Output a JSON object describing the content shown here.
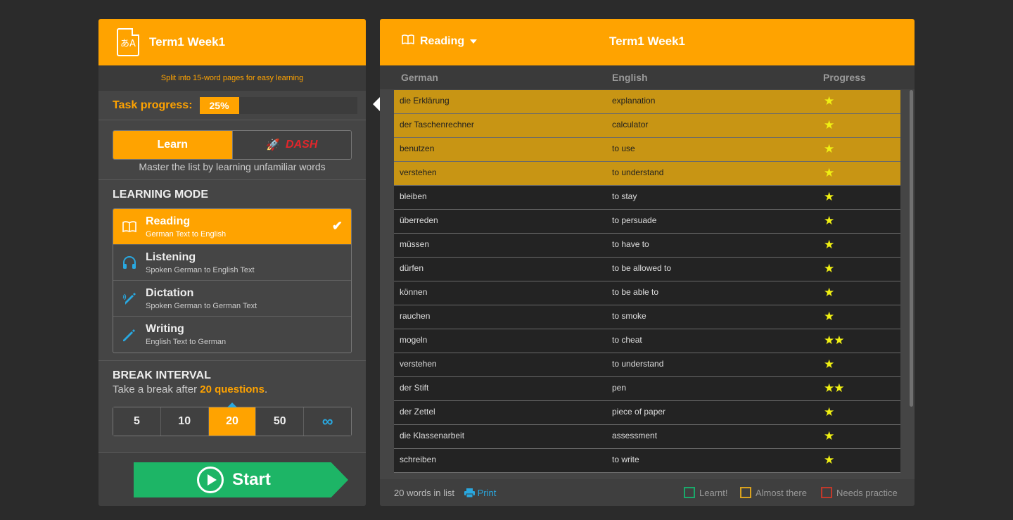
{
  "left": {
    "title": "Term1 Week1",
    "icon": "translate-doc-icon",
    "split_text": "Split into 15-word pages for easy learning",
    "task_label": "Task progress:",
    "task_progress_text": "25%",
    "task_progress": 0.25,
    "learn_label": "Learn",
    "dash_label": "DASH",
    "learn_desc": "Master the list by learning unfamiliar words",
    "mode_section_title": "LEARNING MODE",
    "modes": [
      {
        "name": "Reading",
        "sub": "German Text to English",
        "icon": "book-icon",
        "active": true
      },
      {
        "name": "Listening",
        "sub": "Spoken German to English Text",
        "icon": "headphones-icon",
        "active": false
      },
      {
        "name": "Dictation",
        "sub": "Spoken German to German Text",
        "icon": "dictation-pen-icon",
        "active": false
      },
      {
        "name": "Writing",
        "sub": "English Text to German",
        "icon": "pencil-icon",
        "active": false
      }
    ],
    "break_title": "BREAK INTERVAL",
    "break_prefix": "Take a break after ",
    "break_value": "20 questions",
    "break_suffix": ".",
    "intervals": [
      "5",
      "10",
      "20",
      "50",
      "∞"
    ],
    "selected_interval": "20",
    "start_label": "Start"
  },
  "right": {
    "mode_select": "Reading",
    "title": "Term1 Week1",
    "columns": [
      "German",
      "English",
      "Progress"
    ],
    "rows": [
      {
        "german": "die Erklärung",
        "english": "explanation",
        "stars": 1,
        "status": "almost"
      },
      {
        "german": "der Taschenrechner",
        "english": "calculator",
        "stars": 1,
        "status": "almost"
      },
      {
        "german": "benutzen",
        "english": "to use",
        "stars": 1,
        "status": "almost"
      },
      {
        "german": "verstehen",
        "english": "to understand",
        "stars": 1,
        "status": "almost"
      },
      {
        "german": "bleiben",
        "english": "to stay",
        "stars": 1,
        "status": "none"
      },
      {
        "german": "überreden",
        "english": "to persuade",
        "stars": 1,
        "status": "none"
      },
      {
        "german": "müssen",
        "english": "to have to",
        "stars": 1,
        "status": "none"
      },
      {
        "german": "dürfen",
        "english": "to be allowed to",
        "stars": 1,
        "status": "none"
      },
      {
        "german": "können",
        "english": "to be able to",
        "stars": 1,
        "status": "none"
      },
      {
        "german": "rauchen",
        "english": "to smoke",
        "stars": 1,
        "status": "none"
      },
      {
        "german": "mogeln",
        "english": "to cheat",
        "stars": 2,
        "status": "none"
      },
      {
        "german": "verstehen",
        "english": "to understand",
        "stars": 1,
        "status": "none"
      },
      {
        "german": "der Stift",
        "english": "pen",
        "stars": 2,
        "status": "none"
      },
      {
        "german": "der Zettel",
        "english": "piece of paper",
        "stars": 1,
        "status": "none"
      },
      {
        "german": "die Klassenarbeit",
        "english": "assessment",
        "stars": 1,
        "status": "none"
      },
      {
        "german": "schreiben",
        "english": "to write",
        "stars": 1,
        "status": "none"
      }
    ],
    "word_count": "20 words in list",
    "print_label": "Print",
    "legend": [
      {
        "label": "Learnt!",
        "color": "#1aa86a"
      },
      {
        "label": "Almost there",
        "color": "#d9a21e"
      },
      {
        "label": "Needs practice",
        "color": "#c0392b"
      }
    ]
  },
  "colors": {
    "accent": "#ffa300",
    "start": "#1db566",
    "link": "#29a8e0",
    "star": "#f0f013"
  }
}
